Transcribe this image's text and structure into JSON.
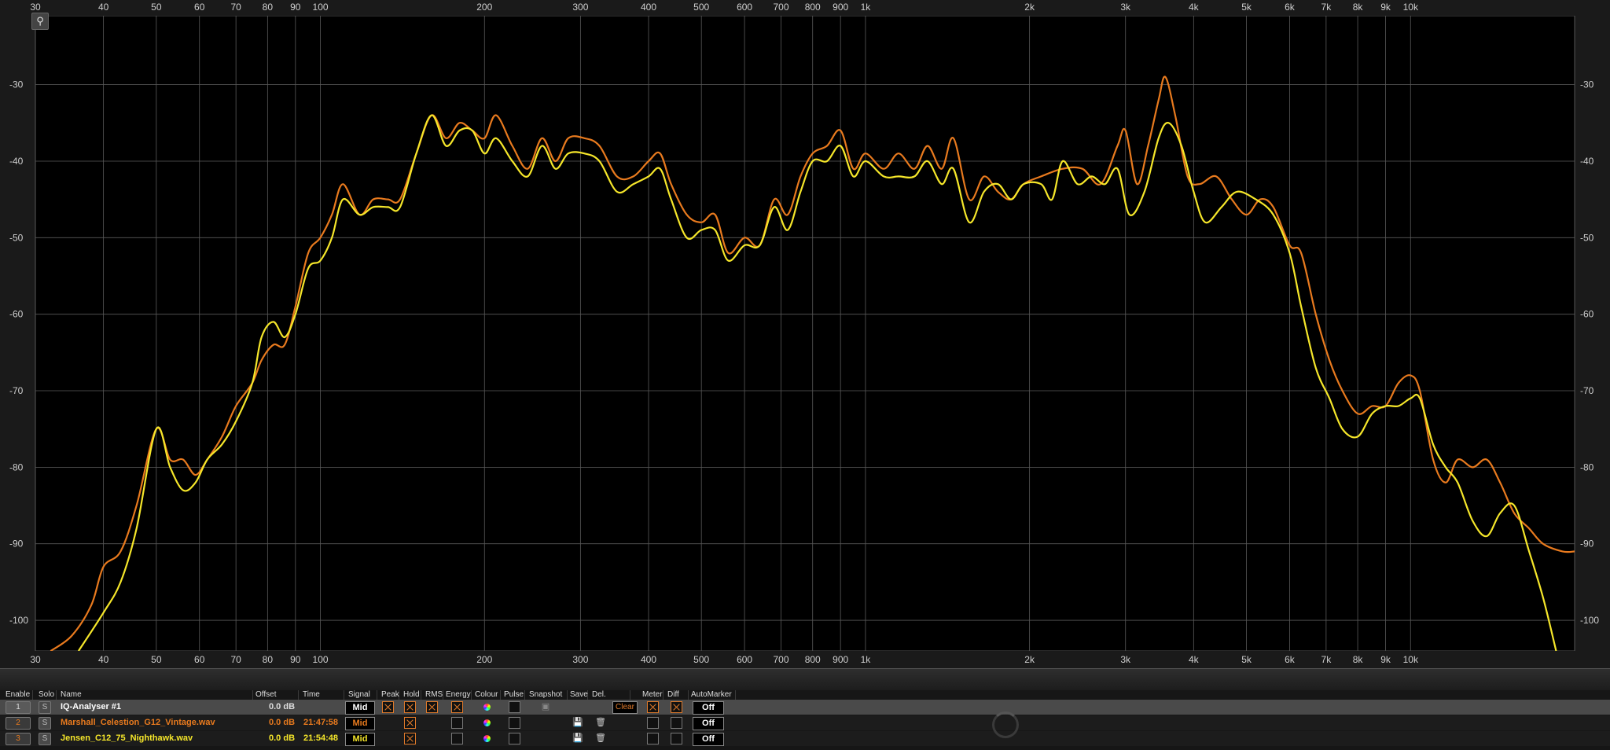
{
  "analyser": {
    "x_axis_labels": [
      "30",
      "40",
      "50",
      "60",
      "70",
      "80",
      "90",
      "100",
      "200",
      "300",
      "400",
      "500",
      "600",
      "700",
      "800",
      "900",
      "1k",
      "2k",
      "3k",
      "4k",
      "5k",
      "6k",
      "7k",
      "8k",
      "9k",
      "10k"
    ],
    "x_axis_freqs": [
      30,
      40,
      50,
      60,
      70,
      80,
      90,
      100,
      200,
      300,
      400,
      500,
      600,
      700,
      800,
      900,
      1000,
      2000,
      3000,
      4000,
      5000,
      6000,
      7000,
      8000,
      9000,
      10000
    ],
    "y_axis_labels": [
      "-30",
      "-40",
      "-50",
      "-60",
      "-70",
      "-80",
      "-90",
      "-100"
    ],
    "zoom_icon": "magnifier-icon",
    "background": "#000000"
  },
  "chart_data": {
    "type": "line",
    "x_scale": "log",
    "xlim": [
      30,
      20000
    ],
    "ylim": [
      -104,
      -21
    ],
    "series": [
      {
        "name": "Marshall_Celestion_G12_Vintage.wav",
        "color": "#e87a1e",
        "points": [
          [
            32,
            -104
          ],
          [
            35,
            -102
          ],
          [
            38,
            -98
          ],
          [
            40,
            -93
          ],
          [
            43,
            -91
          ],
          [
            46,
            -85
          ],
          [
            50,
            -75
          ],
          [
            53,
            -79
          ],
          [
            56,
            -79
          ],
          [
            59,
            -81
          ],
          [
            62,
            -79
          ],
          [
            66,
            -76
          ],
          [
            70,
            -72
          ],
          [
            75,
            -69
          ],
          [
            78,
            -66
          ],
          [
            82,
            -64
          ],
          [
            86,
            -64
          ],
          [
            90,
            -59
          ],
          [
            95,
            -52
          ],
          [
            100,
            -50
          ],
          [
            105,
            -47
          ],
          [
            110,
            -43
          ],
          [
            118,
            -47
          ],
          [
            125,
            -45
          ],
          [
            133,
            -45
          ],
          [
            140,
            -45
          ],
          [
            150,
            -39
          ],
          [
            160,
            -34
          ],
          [
            170,
            -37
          ],
          [
            180,
            -35
          ],
          [
            190,
            -36
          ],
          [
            200,
            -37
          ],
          [
            210,
            -34
          ],
          [
            225,
            -38
          ],
          [
            240,
            -41
          ],
          [
            255,
            -37
          ],
          [
            270,
            -40
          ],
          [
            285,
            -37
          ],
          [
            305,
            -37
          ],
          [
            325,
            -38
          ],
          [
            350,
            -42
          ],
          [
            375,
            -42
          ],
          [
            400,
            -40
          ],
          [
            420,
            -39
          ],
          [
            440,
            -43
          ],
          [
            470,
            -47
          ],
          [
            500,
            -48
          ],
          [
            530,
            -47
          ],
          [
            560,
            -52
          ],
          [
            600,
            -50
          ],
          [
            640,
            -51
          ],
          [
            680,
            -45
          ],
          [
            720,
            -47
          ],
          [
            760,
            -42
          ],
          [
            800,
            -39
          ],
          [
            850,
            -38
          ],
          [
            900,
            -36
          ],
          [
            950,
            -41
          ],
          [
            1000,
            -39
          ],
          [
            1080,
            -41
          ],
          [
            1150,
            -39
          ],
          [
            1230,
            -41
          ],
          [
            1300,
            -38
          ],
          [
            1380,
            -41
          ],
          [
            1450,
            -37
          ],
          [
            1550,
            -45
          ],
          [
            1650,
            -42
          ],
          [
            1750,
            -44
          ],
          [
            1850,
            -45
          ],
          [
            1950,
            -43
          ],
          [
            2100,
            -42
          ],
          [
            2300,
            -41
          ],
          [
            2500,
            -41
          ],
          [
            2700,
            -43
          ],
          [
            2900,
            -38
          ],
          [
            3000,
            -36
          ],
          [
            3150,
            -43
          ],
          [
            3300,
            -38
          ],
          [
            3450,
            -32
          ],
          [
            3550,
            -29
          ],
          [
            3700,
            -34
          ],
          [
            3900,
            -42
          ],
          [
            4100,
            -43
          ],
          [
            4400,
            -42
          ],
          [
            4700,
            -45
          ],
          [
            5000,
            -47
          ],
          [
            5300,
            -45
          ],
          [
            5600,
            -46
          ],
          [
            6000,
            -51
          ],
          [
            6300,
            -52
          ],
          [
            6700,
            -60
          ],
          [
            7100,
            -66
          ],
          [
            7500,
            -70
          ],
          [
            8000,
            -73
          ],
          [
            8500,
            -72
          ],
          [
            9000,
            -72
          ],
          [
            9500,
            -69
          ],
          [
            10000,
            -68
          ],
          [
            10400,
            -70
          ],
          [
            11000,
            -79
          ],
          [
            11600,
            -82
          ],
          [
            12200,
            -79
          ],
          [
            13000,
            -80
          ],
          [
            13800,
            -79
          ],
          [
            14600,
            -82
          ],
          [
            15500,
            -86
          ],
          [
            16500,
            -88
          ],
          [
            17500,
            -90
          ],
          [
            19000,
            -91
          ],
          [
            20000,
            -91
          ]
        ]
      },
      {
        "name": "Jensen_C12_75_Nighthawk.wav",
        "color": "#f5e62a",
        "points": [
          [
            36,
            -104
          ],
          [
            40,
            -99
          ],
          [
            43,
            -95
          ],
          [
            46,
            -88
          ],
          [
            50,
            -75
          ],
          [
            53,
            -80
          ],
          [
            56,
            -83
          ],
          [
            59,
            -82
          ],
          [
            62,
            -79
          ],
          [
            66,
            -77
          ],
          [
            70,
            -74
          ],
          [
            75,
            -69
          ],
          [
            78,
            -63
          ],
          [
            82,
            -61
          ],
          [
            86,
            -63
          ],
          [
            90,
            -60
          ],
          [
            95,
            -54
          ],
          [
            100,
            -53
          ],
          [
            105,
            -50
          ],
          [
            110,
            -45
          ],
          [
            118,
            -47
          ],
          [
            125,
            -46
          ],
          [
            133,
            -46
          ],
          [
            140,
            -46
          ],
          [
            150,
            -39
          ],
          [
            160,
            -34
          ],
          [
            170,
            -38
          ],
          [
            180,
            -36
          ],
          [
            190,
            -36
          ],
          [
            200,
            -39
          ],
          [
            210,
            -37
          ],
          [
            225,
            -40
          ],
          [
            240,
            -42
          ],
          [
            255,
            -38
          ],
          [
            270,
            -41
          ],
          [
            285,
            -39
          ],
          [
            305,
            -39
          ],
          [
            325,
            -40
          ],
          [
            350,
            -44
          ],
          [
            375,
            -43
          ],
          [
            400,
            -42
          ],
          [
            420,
            -41
          ],
          [
            440,
            -45
          ],
          [
            470,
            -50
          ],
          [
            500,
            -49
          ],
          [
            530,
            -49
          ],
          [
            560,
            -53
          ],
          [
            600,
            -51
          ],
          [
            640,
            -51
          ],
          [
            680,
            -46
          ],
          [
            720,
            -49
          ],
          [
            760,
            -44
          ],
          [
            800,
            -40
          ],
          [
            850,
            -40
          ],
          [
            900,
            -38
          ],
          [
            950,
            -42
          ],
          [
            1000,
            -40
          ],
          [
            1080,
            -42
          ],
          [
            1150,
            -42
          ],
          [
            1230,
            -42
          ],
          [
            1300,
            -40
          ],
          [
            1380,
            -43
          ],
          [
            1450,
            -41
          ],
          [
            1550,
            -48
          ],
          [
            1650,
            -44
          ],
          [
            1750,
            -43
          ],
          [
            1850,
            -45
          ],
          [
            1950,
            -43
          ],
          [
            2100,
            -43
          ],
          [
            2200,
            -45
          ],
          [
            2300,
            -40
          ],
          [
            2450,
            -43
          ],
          [
            2600,
            -42
          ],
          [
            2750,
            -43
          ],
          [
            2900,
            -41
          ],
          [
            3050,
            -47
          ],
          [
            3250,
            -44
          ],
          [
            3450,
            -37
          ],
          [
            3600,
            -35
          ],
          [
            3800,
            -38
          ],
          [
            4000,
            -44
          ],
          [
            4200,
            -48
          ],
          [
            4500,
            -46
          ],
          [
            4800,
            -44
          ],
          [
            5200,
            -45
          ],
          [
            5600,
            -47
          ],
          [
            6000,
            -52
          ],
          [
            6300,
            -59
          ],
          [
            6700,
            -67
          ],
          [
            7100,
            -71
          ],
          [
            7500,
            -75
          ],
          [
            8000,
            -76
          ],
          [
            8500,
            -73
          ],
          [
            9000,
            -72
          ],
          [
            9500,
            -72
          ],
          [
            10000,
            -71
          ],
          [
            10400,
            -71
          ],
          [
            11000,
            -77
          ],
          [
            11600,
            -80
          ],
          [
            12200,
            -82
          ],
          [
            13000,
            -87
          ],
          [
            13800,
            -89
          ],
          [
            14600,
            -86
          ],
          [
            15500,
            -85
          ],
          [
            16500,
            -91
          ],
          [
            17500,
            -97
          ],
          [
            18500,
            -104
          ]
        ]
      }
    ]
  },
  "table": {
    "headers": [
      "Enable",
      "Solo",
      "Name",
      "Offset",
      "Time",
      "Signal",
      "Peak",
      "Hold",
      "RMS",
      "Energy",
      "Colour",
      "Pulse",
      "Snapshot",
      "Save",
      "Del.",
      "Meter",
      "Diff",
      "AutoMarker"
    ],
    "solo_label": "S",
    "clear_label": "Clear",
    "rows": [
      {
        "index": "1",
        "name": "IQ-Analyser #1",
        "offset": "0.0 dB",
        "time": "",
        "signal": "Mid",
        "automarker": "Off",
        "name_color": "#ffffff"
      },
      {
        "index": "2",
        "name": "Marshall_Celestion_G12_Vintage.wav",
        "offset": "0.0 dB",
        "time": "21:47:58",
        "signal": "Mid",
        "automarker": "Off",
        "name_color": "#e87a1e"
      },
      {
        "index": "3",
        "name": "Jensen_C12_75_Nighthawk.wav",
        "offset": "0.0 dB",
        "time": "21:54:48",
        "signal": "Mid",
        "automarker": "Off",
        "name_color": "#f5e62a"
      }
    ]
  }
}
